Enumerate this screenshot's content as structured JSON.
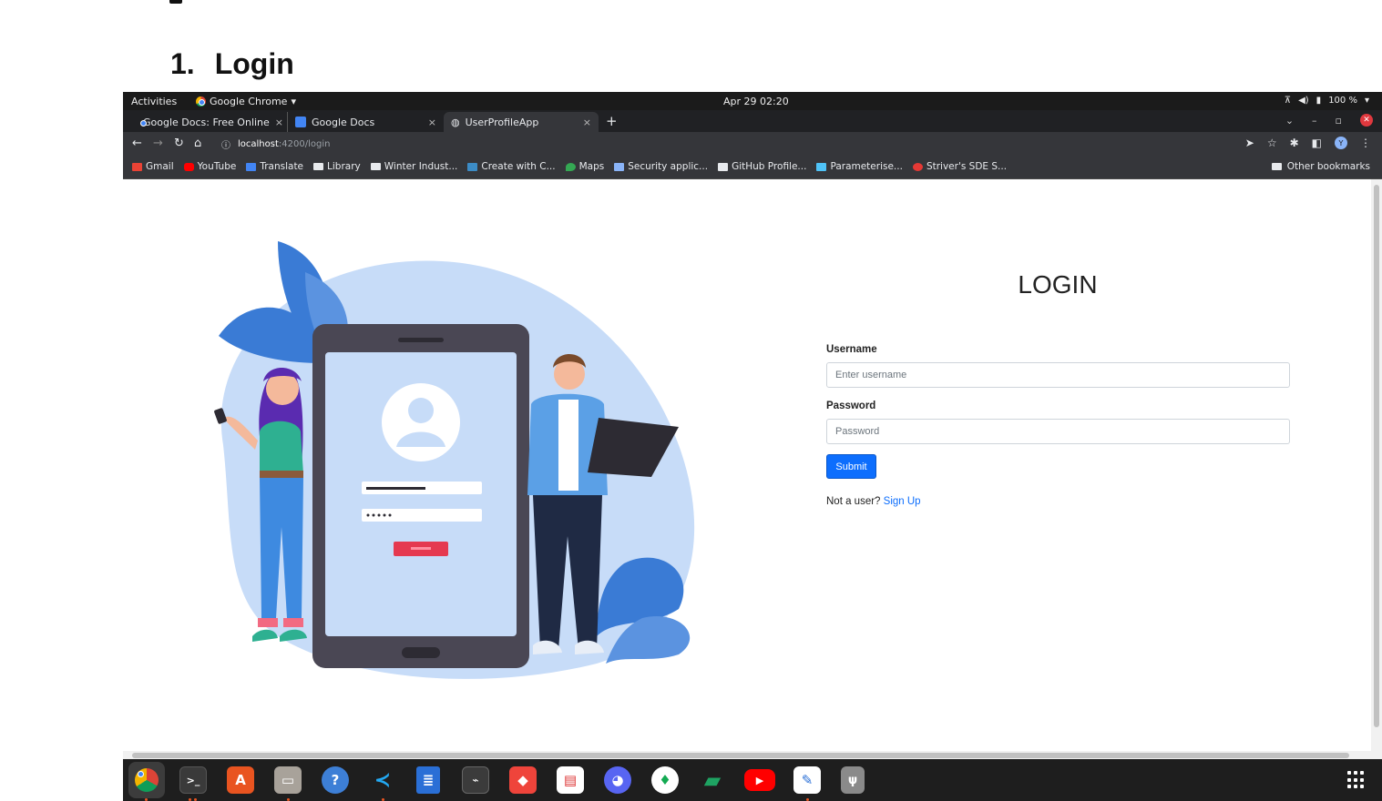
{
  "document": {
    "heading_number": "1.",
    "heading_text": "Login"
  },
  "topbar": {
    "activities": "Activities",
    "app_name": "Google Chrome",
    "clock": "Apr 29  02:20",
    "battery": "100 %"
  },
  "tabs": [
    {
      "title": "Google Docs: Free Online",
      "active": false
    },
    {
      "title": "Google Docs",
      "active": false
    },
    {
      "title": "UserProfileApp",
      "active": true
    }
  ],
  "address": {
    "host": "localhost",
    "path": ":4200/login"
  },
  "bookmarks": [
    {
      "label": "Gmail",
      "icon": "gmail-icon",
      "color": "#ea4335"
    },
    {
      "label": "YouTube",
      "icon": "youtube-icon",
      "color": "#ff0000"
    },
    {
      "label": "Translate",
      "icon": "translate-icon",
      "color": "#4285f4"
    },
    {
      "label": "Library",
      "icon": "folder-icon",
      "color": "#e8eaed"
    },
    {
      "label": "Winter Indust...",
      "icon": "folder-icon",
      "color": "#e8eaed"
    },
    {
      "label": "Create with C...",
      "icon": "vscode-icon",
      "color": "#3c8cc6"
    },
    {
      "label": "Maps",
      "icon": "maps-icon",
      "color": "#34a853"
    },
    {
      "label": "Security applic...",
      "icon": "doc-icon",
      "color": "#8ab4f8"
    },
    {
      "label": "GitHub Profile...",
      "icon": "doc-icon",
      "color": "#e8eaed"
    },
    {
      "label": "Parameterise...",
      "icon": "bot-icon",
      "color": "#4fc3f7"
    },
    {
      "label": "Striver's SDE S...",
      "icon": "site-icon",
      "color": "#e53935"
    }
  ],
  "other_bookmarks": "Other bookmarks",
  "login": {
    "title": "LOGIN",
    "username_label": "Username",
    "username_placeholder": "Enter username",
    "password_label": "Password",
    "password_placeholder": "Password",
    "submit": "Submit",
    "signup_prompt": "Not a user?",
    "signup_link": "Sign Up"
  },
  "profile_initial": "Y",
  "dock": [
    {
      "name": "chrome-icon",
      "color": "#3c3c3c"
    },
    {
      "name": "terminal-icon",
      "color": "#3a3a3a"
    },
    {
      "name": "software-center-icon",
      "color": "#e95420"
    },
    {
      "name": "files-icon",
      "color": "#a8a29a"
    },
    {
      "name": "help-icon",
      "color": "#3d7fd6"
    },
    {
      "name": "vscode-icon",
      "color": "#1e1e1e"
    },
    {
      "name": "text-editor-icon",
      "color": "#2a6fd6"
    },
    {
      "name": "system-monitor-icon",
      "color": "#3b3b3b"
    },
    {
      "name": "anydesk-icon",
      "color": "#ef443b"
    },
    {
      "name": "document-viewer-icon",
      "color": "#ffffff"
    },
    {
      "name": "discord-icon",
      "color": "#5865f2"
    },
    {
      "name": "mongodb-compass-icon",
      "color": "#ffffff"
    },
    {
      "name": "google-chat-icon",
      "color": "#1e1e1e"
    },
    {
      "name": "youtube-icon",
      "color": "#1e1e1e"
    },
    {
      "name": "notes-icon",
      "color": "#ffffff"
    },
    {
      "name": "usb-drive-icon",
      "color": "#8a8a8a"
    }
  ]
}
